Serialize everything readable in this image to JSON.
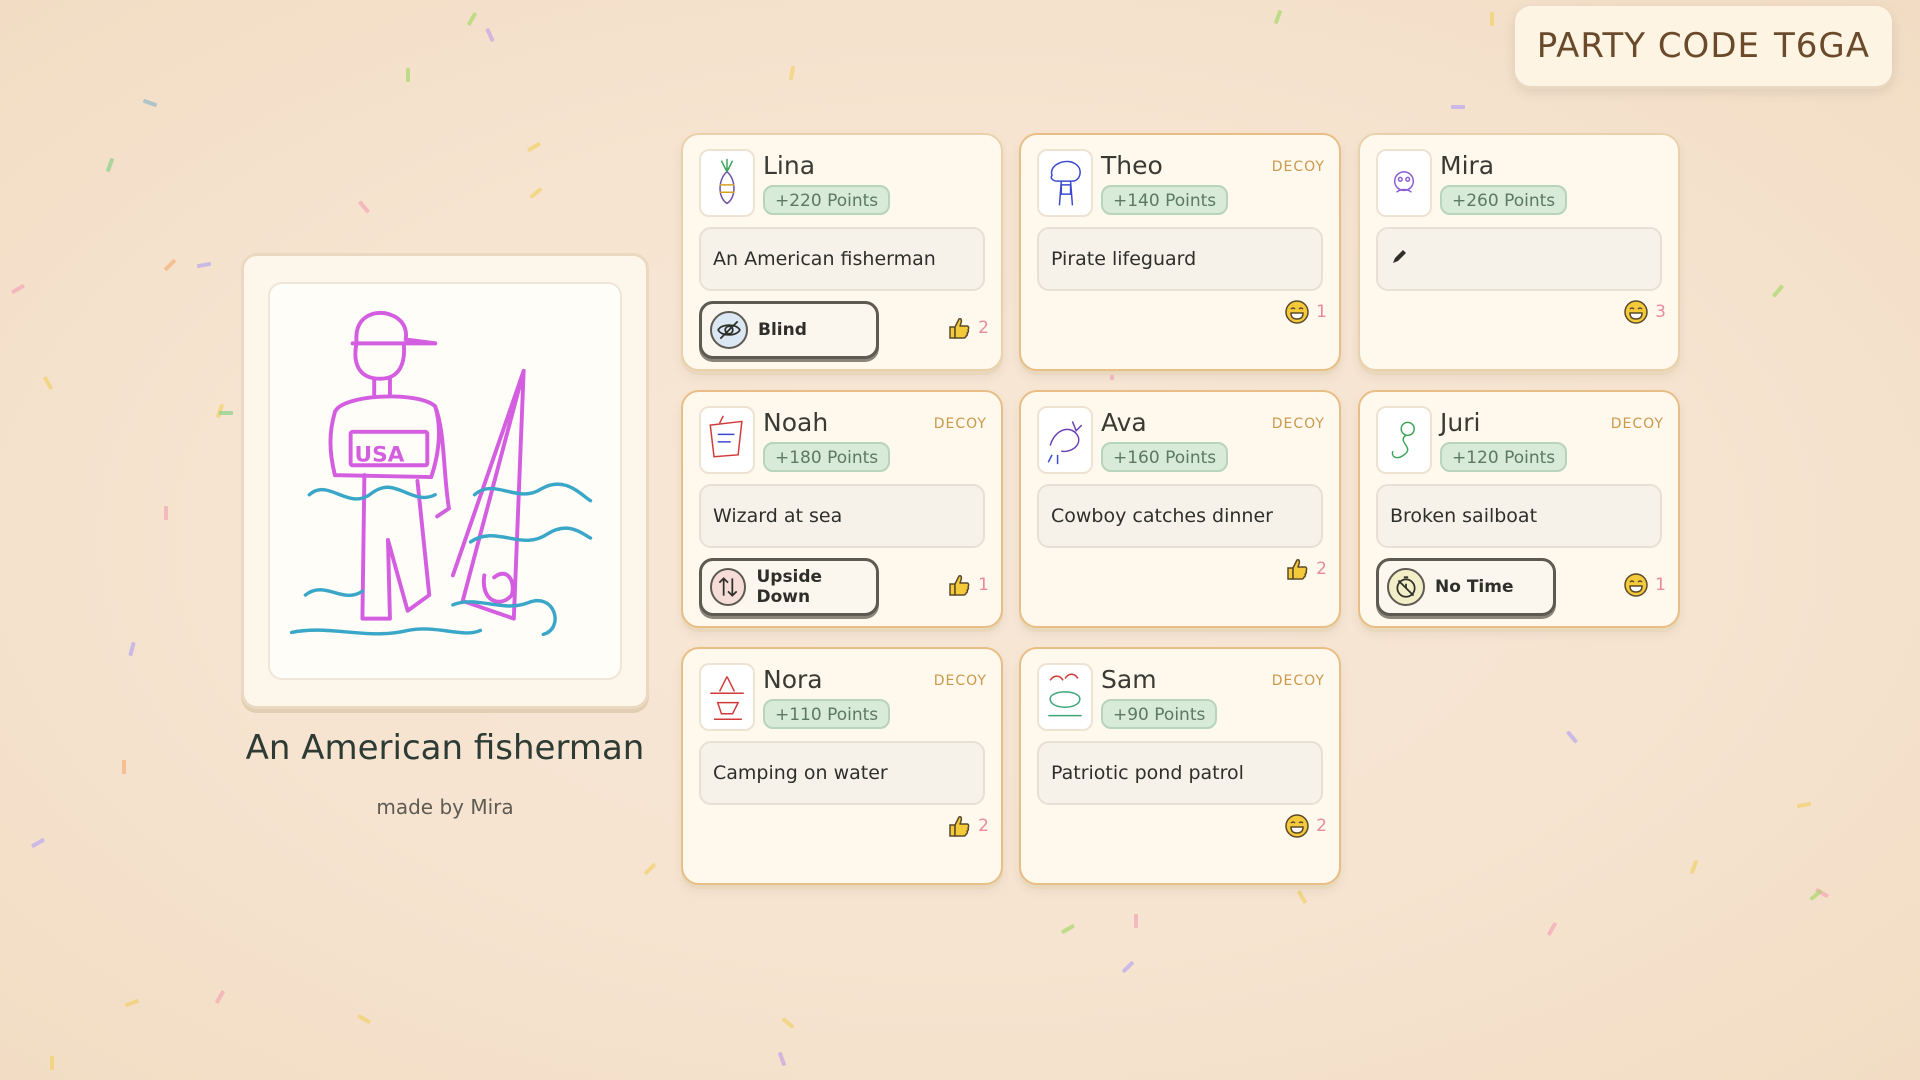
{
  "party_code": {
    "label": "PARTY CODE",
    "code": "T6GA"
  },
  "drawing": {
    "title": "An American fisherman",
    "made_by": "made by Mira",
    "shirt_text": "USA"
  },
  "cards": [
    {
      "name": "Lina",
      "points": "+220 Points",
      "decoy": "",
      "answer": "An American fisherman",
      "modifier": "Blind",
      "modifier_icon": "eye-slash-icon",
      "reaction_icon": "thumbs-up-icon",
      "reaction_count": "2"
    },
    {
      "name": "Theo",
      "points": "+140 Points",
      "decoy": "DECOY",
      "answer": "Pirate lifeguard",
      "modifier": "",
      "modifier_icon": "",
      "reaction_icon": "laugh-emoji-icon",
      "reaction_count": "1"
    },
    {
      "name": "Mira",
      "points": "+260 Points",
      "decoy": "",
      "answer": "",
      "answer_icon": "pencil-icon",
      "modifier": "",
      "modifier_icon": "",
      "reaction_icon": "laugh-emoji-icon",
      "reaction_count": "3"
    },
    {
      "name": "Noah",
      "points": "+180 Points",
      "decoy": "DECOY",
      "answer": "Wizard at sea",
      "modifier": "Upside Down",
      "modifier_icon": "arrows-up-down-icon",
      "reaction_icon": "thumbs-up-icon",
      "reaction_count": "1"
    },
    {
      "name": "Ava",
      "points": "+160 Points",
      "decoy": "DECOY",
      "answer": "Cowboy catches dinner",
      "modifier": "",
      "modifier_icon": "",
      "reaction_icon": "thumbs-up-icon",
      "reaction_count": "2"
    },
    {
      "name": "Juri",
      "points": "+120 Points",
      "decoy": "DECOY",
      "answer": "Broken sailboat",
      "modifier": "No Time",
      "modifier_icon": "no-timer-icon",
      "reaction_icon": "laugh-emoji-icon",
      "reaction_count": "1"
    },
    {
      "name": "Nora",
      "points": "+110 Points",
      "decoy": "DECOY",
      "answer": "Camping on water",
      "modifier": "",
      "modifier_icon": "",
      "reaction_icon": "thumbs-up-icon",
      "reaction_count": "2"
    },
    {
      "name": "Sam",
      "points": "+90 Points",
      "decoy": "DECOY",
      "answer": "Patriotic pond patrol",
      "modifier": "",
      "modifier_icon": "",
      "reaction_icon": "laugh-emoji-icon",
      "reaction_count": "2"
    }
  ],
  "colors": {
    "background": "#f6e4d0",
    "card": "#fff8ec",
    "card_border": "#e9d2ab",
    "decoy_border": "#e7bf86",
    "decoy_text": "#c9994c",
    "points_bg": "#d8ead8",
    "points_text": "#5c7a62",
    "reaction": "#e88aa0",
    "drawing_stroke": "#d45ee0"
  }
}
